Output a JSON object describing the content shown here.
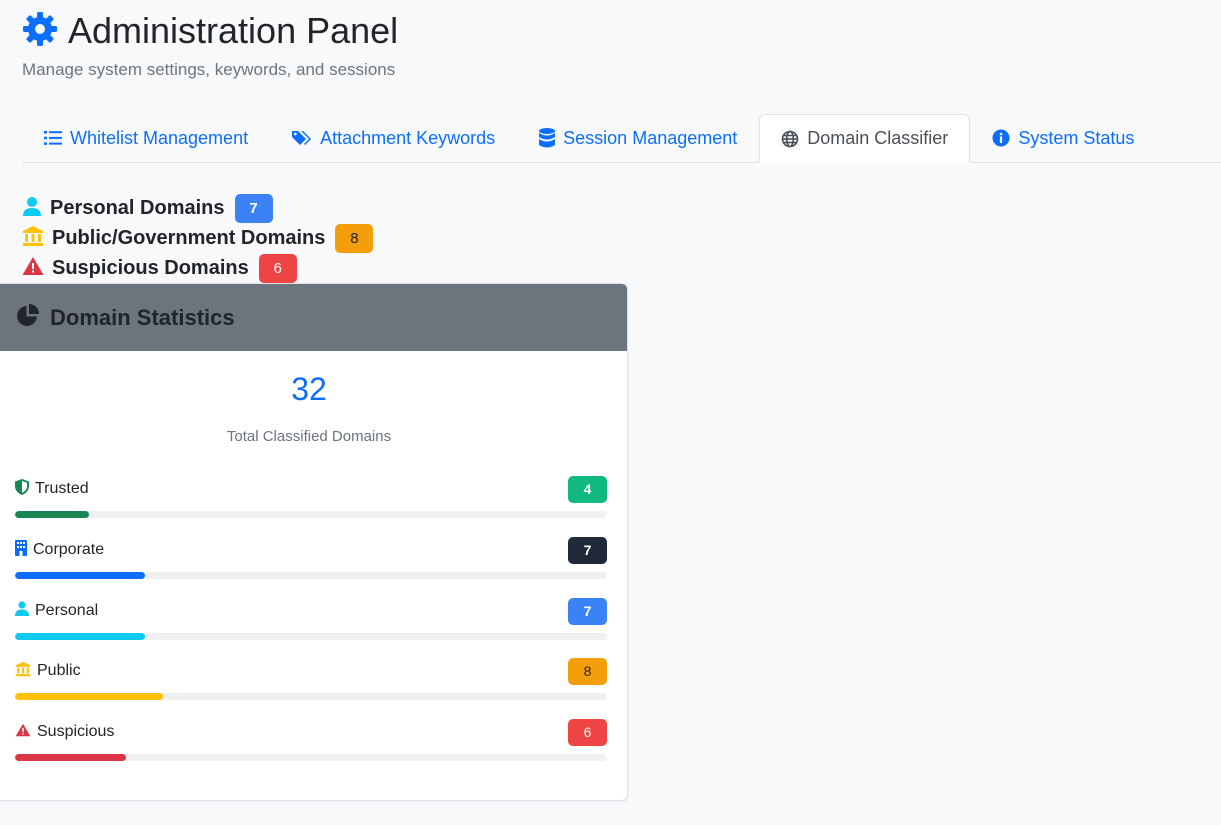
{
  "header": {
    "title": "Administration Panel",
    "subtitle": "Manage system settings, keywords, and sessions",
    "icon": "gear-icon"
  },
  "tabs": [
    {
      "label": "Whitelist Management",
      "icon": "list-icon",
      "active": false
    },
    {
      "label": "Attachment Keywords",
      "icon": "tags-icon",
      "active": false
    },
    {
      "label": "Session Management",
      "icon": "database-icon",
      "active": false
    },
    {
      "label": "Domain Classifier",
      "icon": "globe-icon",
      "active": true
    },
    {
      "label": "System Status",
      "icon": "info-circle-icon",
      "active": false
    }
  ],
  "categories": [
    {
      "label": "Personal Domains",
      "count": "7",
      "icon": "user-icon",
      "color": "#0dcaf0",
      "badge_bg": "#3b82f6",
      "badge_fg": "#ffffff"
    },
    {
      "label": "Public/Government Domains",
      "count": "8",
      "icon": "bank-icon",
      "color": "#ffc107",
      "badge_bg": "#f59e0b",
      "badge_fg": "#212529"
    },
    {
      "label": "Suspicious Domains",
      "count": "6",
      "icon": "warning-icon",
      "color": "#dc3545",
      "badge_bg": "#ef4444",
      "badge_fg": "#ffffff"
    }
  ],
  "stats_card": {
    "title": "Domain Statistics",
    "icon": "pie-chart-icon",
    "total": "32",
    "total_label": "Total Classified Domains",
    "items": [
      {
        "label": "Trusted",
        "count": "4",
        "icon": "shield-icon",
        "icon_color": "#198754",
        "bar_color": "#198754",
        "badge_bg": "#10b981",
        "badge_fg": "#ffffff",
        "fraction": 0.125
      },
      {
        "label": "Corporate",
        "count": "7",
        "icon": "building-icon",
        "icon_color": "#0d6efd",
        "bar_color": "#0d6efd",
        "badge_bg": "#1f2937",
        "badge_fg": "#ffffff",
        "fraction": 0.219
      },
      {
        "label": "Personal",
        "count": "7",
        "icon": "user-icon",
        "icon_color": "#0dcaf0",
        "bar_color": "#0dcaf0",
        "badge_bg": "#3b82f6",
        "badge_fg": "#ffffff",
        "fraction": 0.219
      },
      {
        "label": "Public",
        "count": "8",
        "icon": "bank-icon",
        "icon_color": "#ffc107",
        "bar_color": "#ffc107",
        "badge_bg": "#f59e0b",
        "badge_fg": "#212529",
        "fraction": 0.25
      },
      {
        "label": "Suspicious",
        "count": "6",
        "icon": "warning-icon",
        "icon_color": "#dc3545",
        "bar_color": "#dc3545",
        "badge_bg": "#ef4444",
        "badge_fg": "#ffffff",
        "fraction": 0.188
      }
    ]
  }
}
